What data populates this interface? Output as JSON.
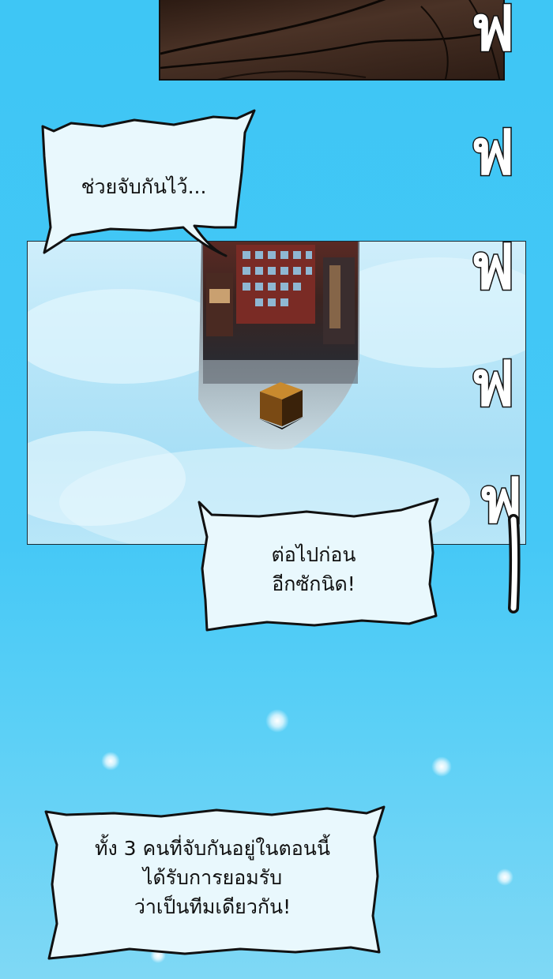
{
  "bubbles": {
    "bubble_1": "ช่วยจับกันไว้...",
    "bubble_2": "ต่อไปก่อน\nอีกซักนิด!",
    "bubble_3": "ทั้ง 3 คนที่จับกันอยู่ในตอนนี้\nได้รับการยอมรับ\nว่าเป็นทีมเดียวกัน!"
  },
  "sfx": [
    "ฟ",
    "ฟ",
    "ฟ",
    "ฟ",
    "ฟ"
  ],
  "colors": {
    "sky": "#45c8f6",
    "bubble_fill": "#e9f8fd",
    "outline": "#111111"
  }
}
